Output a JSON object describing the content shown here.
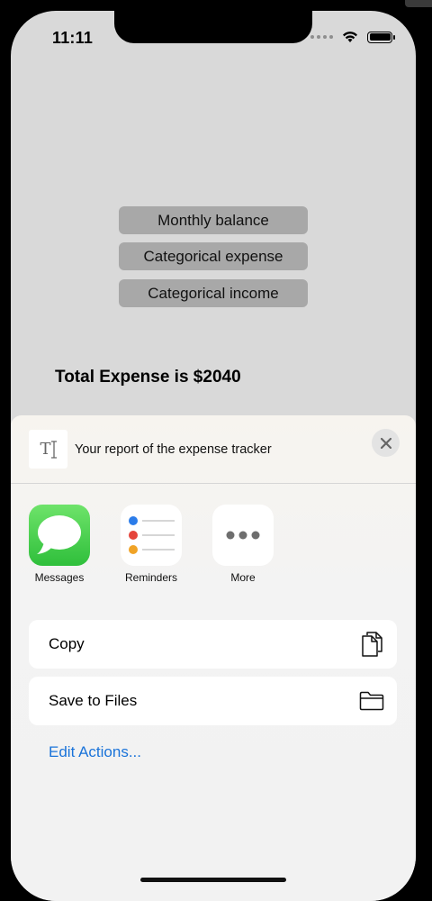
{
  "status_bar": {
    "time": "11:11"
  },
  "menu": {
    "buttons": [
      "Monthly balance",
      "Categorical expense",
      "Categorical income"
    ]
  },
  "summary": {
    "total_text": "Total Expense is $2040"
  },
  "share_sheet": {
    "title": "Your report of the expense tracker",
    "doc_glyph": "T",
    "apps": [
      {
        "label": "Messages",
        "icon": "messages-icon"
      },
      {
        "label": "Reminders",
        "icon": "reminders-icon"
      },
      {
        "label": "More",
        "icon": "more-icon"
      }
    ],
    "actions": [
      {
        "label": "Copy",
        "icon": "copy-icon"
      },
      {
        "label": "Save to Files",
        "icon": "folder-icon"
      }
    ],
    "edit_actions": "Edit Actions...",
    "colors": {
      "link": "#1a73d9",
      "messages_green": "#34c759",
      "sheet_bg": "#f2f2f2"
    }
  }
}
